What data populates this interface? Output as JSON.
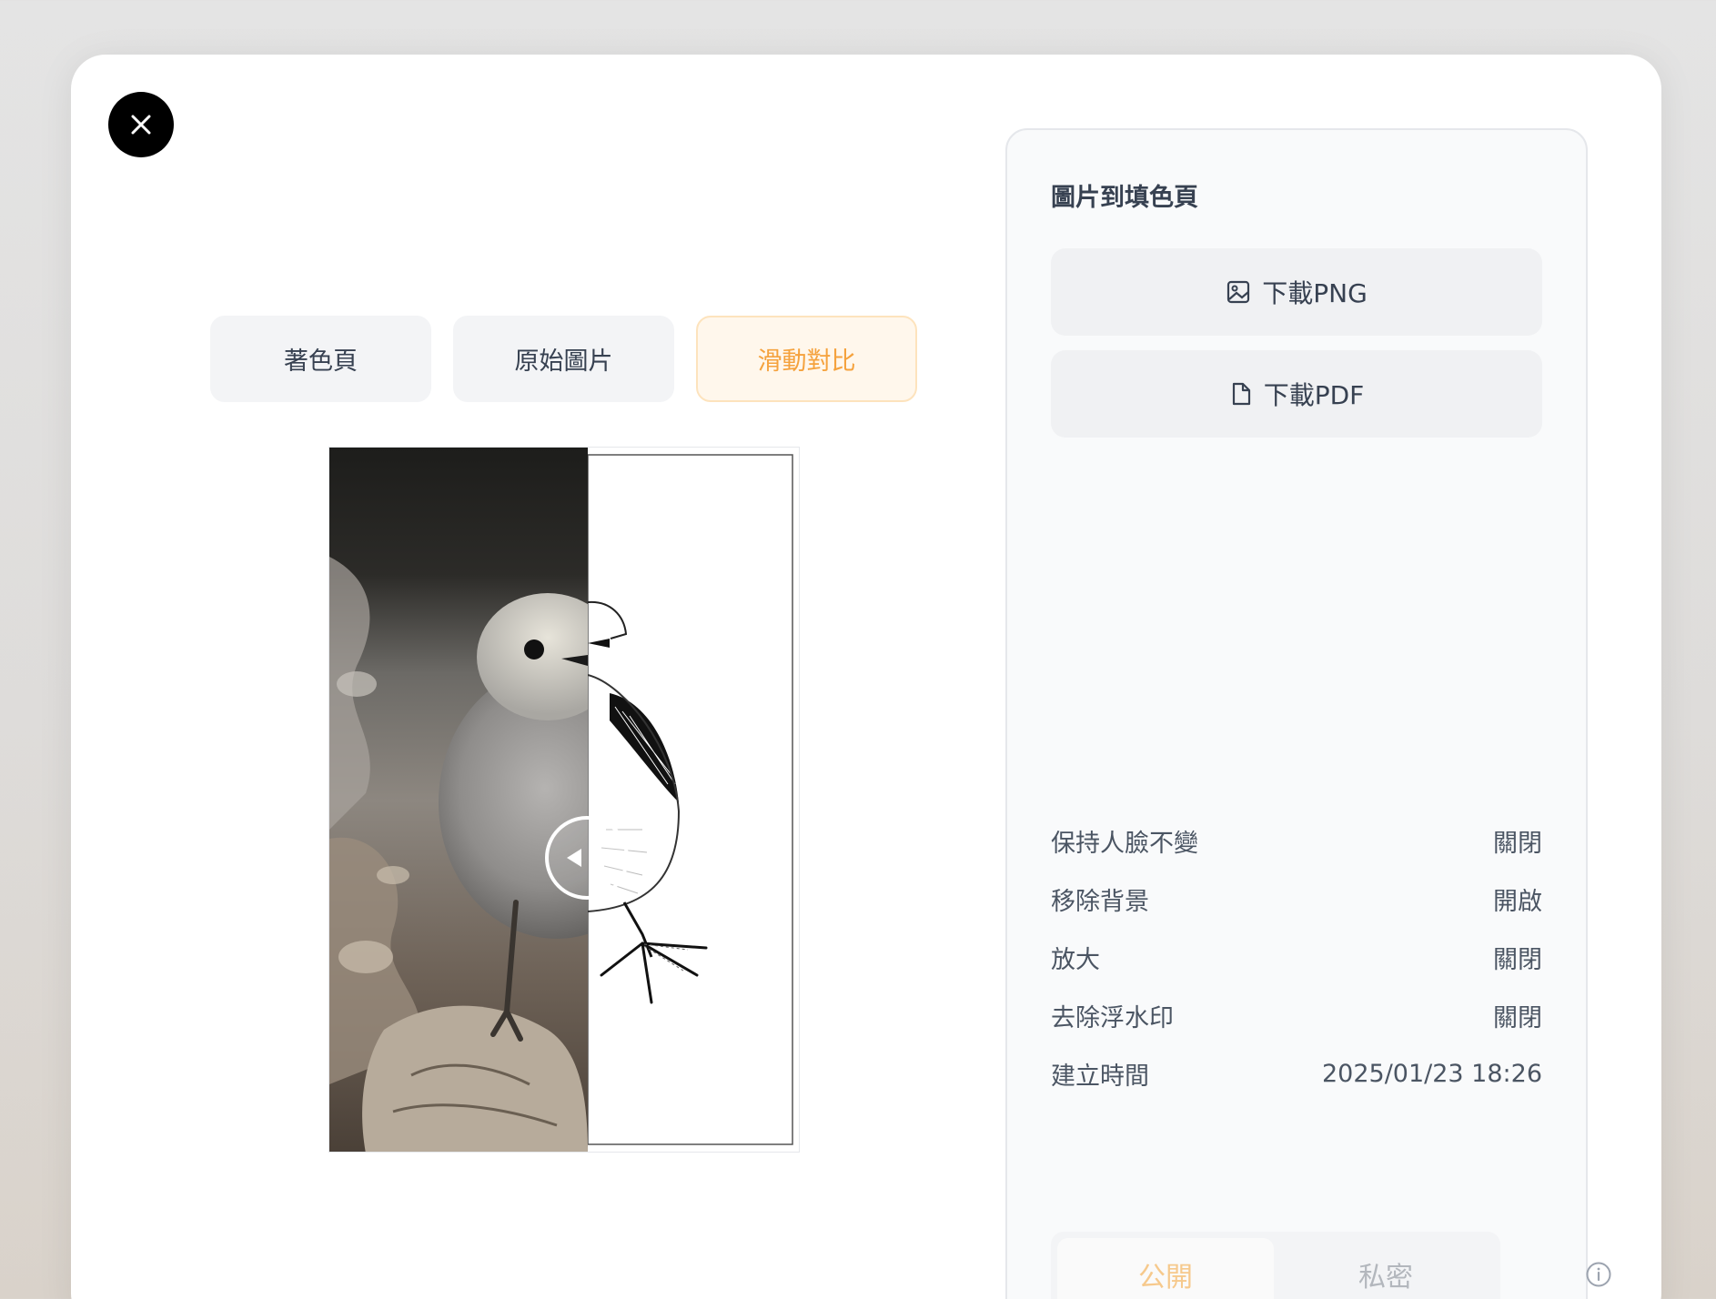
{
  "modal": {
    "close_icon": "close-icon",
    "tabs": [
      {
        "label": "著色頁",
        "active": false
      },
      {
        "label": "原始圖片",
        "active": false
      },
      {
        "label": "滑動對比",
        "active": true
      }
    ]
  },
  "preview": {
    "left_label": "photo of bird",
    "right_label": "coloring page line art"
  },
  "panel": {
    "title": "圖片到填色頁",
    "download_png": {
      "icon": "image-icon",
      "label": "下載PNG"
    },
    "download_pdf": {
      "icon": "file-icon",
      "label": "下載PDF"
    },
    "settings": [
      {
        "label": "保持人臉不變",
        "value": "關閉"
      },
      {
        "label": "移除背景",
        "value": "開啟"
      },
      {
        "label": "放大",
        "value": "關閉"
      },
      {
        "label": "去除浮水印",
        "value": "關閉"
      },
      {
        "label": "建立時間",
        "value": "2025/01/23 18:26"
      }
    ],
    "visibility": {
      "options": [
        "公開",
        "私密"
      ],
      "selected": "公開"
    }
  },
  "colors": {
    "accent": "#f5a23d",
    "accent_bg": "#fff7ec"
  }
}
